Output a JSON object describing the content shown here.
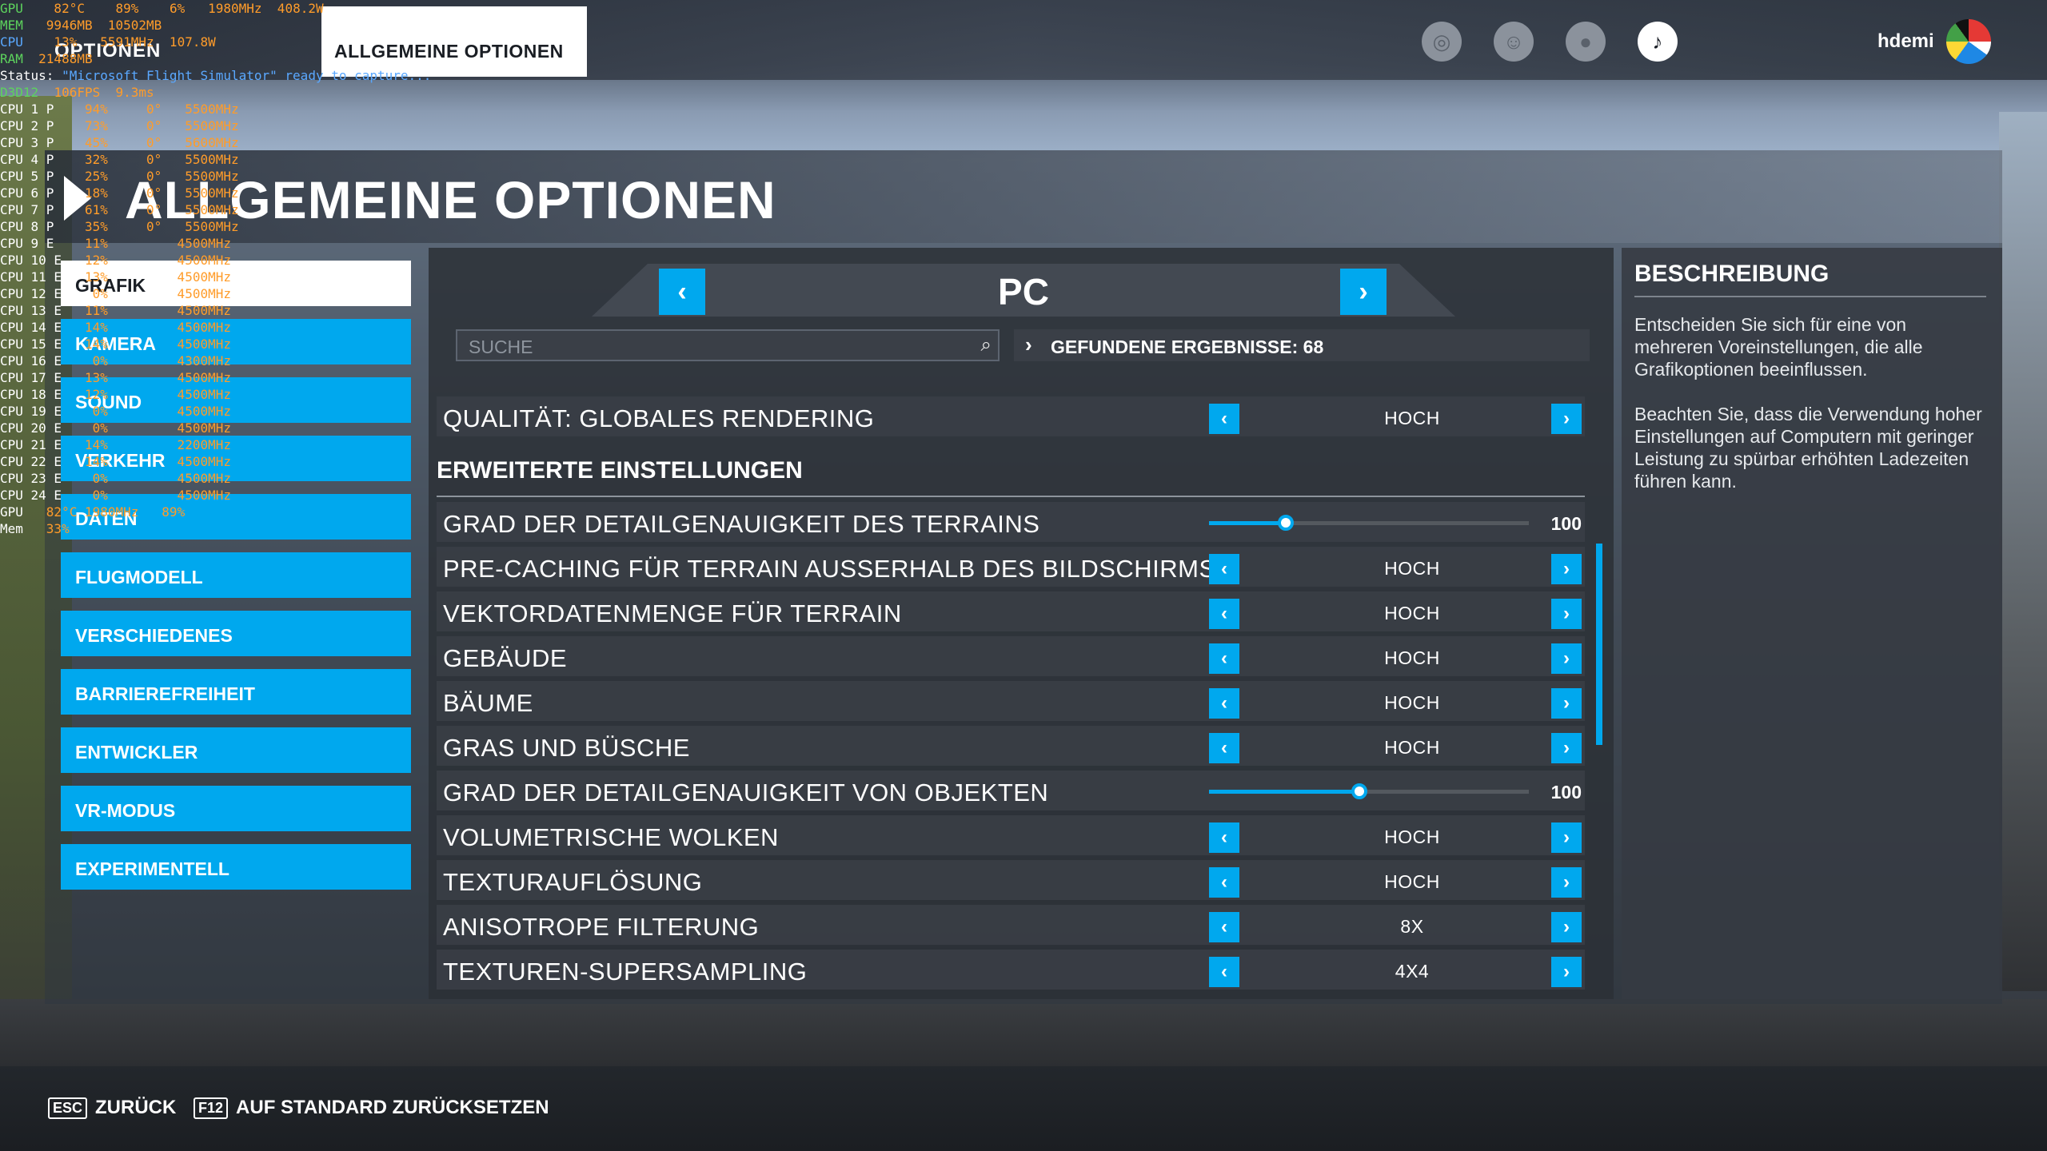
{
  "hud": {
    "rows": [
      {
        "label": "GPU",
        "v1": "82",
        "u1": "°C",
        "v2": "89",
        "u2": "%",
        "v3": "6",
        "u3": "%",
        "v4": "1980",
        "u4": "MHz",
        "v5": "408.2",
        "u5": "W"
      },
      {
        "label": "MEM",
        "v1": "9946",
        "u1": "MB",
        "v2": "10502",
        "u2": "MB",
        "v3": "",
        "u3": "",
        "v4": "",
        "u4": "",
        "v5": "",
        "u5": ""
      },
      {
        "label": "CPU",
        "v1": "13",
        "u1": "%",
        "v2": "5591",
        "u2": "MHz",
        "v3": "107.8",
        "u3": "W",
        "v4": "",
        "u4": "",
        "v5": "",
        "u5": ""
      },
      {
        "label": "RAM",
        "v1": "21488",
        "u1": "MB",
        "v2": "",
        "u2": "",
        "v3": "",
        "u3": "",
        "v4": "",
        "u4": "",
        "v5": "",
        "u5": ""
      }
    ],
    "status_label": "Status:",
    "status_text": "\"Microsoft Flight Simulator\" ready to capture...",
    "d3d_label": "D3D12",
    "d3d_fps": "106",
    "d3d_fps_unit": "FPS",
    "d3d_ms": "9.3",
    "d3d_ms_unit": "ms",
    "cpus": [
      {
        "name": "CPU 1 P",
        "load": "94",
        "temp": "0",
        "freq": "5500"
      },
      {
        "name": "CPU 2 P",
        "load": "73",
        "temp": "0",
        "freq": "5500"
      },
      {
        "name": "CPU 3 P",
        "load": "45",
        "temp": "0",
        "freq": "5600"
      },
      {
        "name": "CPU 4 P",
        "load": "32",
        "temp": "0",
        "freq": "5500"
      },
      {
        "name": "CPU 5 P",
        "load": "25",
        "temp": "0",
        "freq": "5500"
      },
      {
        "name": "CPU 6 P",
        "load": "18",
        "temp": "0",
        "freq": "5500"
      },
      {
        "name": "CPU 7 P",
        "load": "61",
        "temp": "0",
        "freq": "5500"
      },
      {
        "name": "CPU 8 P",
        "load": "35",
        "temp": "0",
        "freq": "5500"
      },
      {
        "name": "CPU 9 E",
        "load": "11",
        "temp": "",
        "freq": "4500"
      },
      {
        "name": "CPU 10 E",
        "load": "12",
        "temp": "",
        "freq": "4500"
      },
      {
        "name": "CPU 11 E",
        "load": "13",
        "temp": "",
        "freq": "4500"
      },
      {
        "name": "CPU 12 E",
        "load": "0",
        "temp": "",
        "freq": "4500"
      },
      {
        "name": "CPU 13 E",
        "load": "11",
        "temp": "",
        "freq": "4500"
      },
      {
        "name": "CPU 14 E",
        "load": "14",
        "temp": "",
        "freq": "4500"
      },
      {
        "name": "CPU 15 E",
        "load": "14",
        "temp": "",
        "freq": "4500"
      },
      {
        "name": "CPU 16 E",
        "load": "0",
        "temp": "",
        "freq": "4300"
      },
      {
        "name": "CPU 17 E",
        "load": "13",
        "temp": "",
        "freq": "4500"
      },
      {
        "name": "CPU 18 E",
        "load": "12",
        "temp": "",
        "freq": "4500"
      },
      {
        "name": "CPU 19 E",
        "load": "0",
        "temp": "",
        "freq": "4500"
      },
      {
        "name": "CPU 20 E",
        "load": "0",
        "temp": "",
        "freq": "4500"
      },
      {
        "name": "CPU 21 E",
        "load": "14",
        "temp": "",
        "freq": "2200"
      },
      {
        "name": "CPU 22 E",
        "load": "14",
        "temp": "",
        "freq": "4500"
      },
      {
        "name": "CPU 23 E",
        "load": "0",
        "temp": "",
        "freq": "4500"
      },
      {
        "name": "CPU 24 E",
        "load": "0",
        "temp": "",
        "freq": "4500"
      }
    ],
    "gpu2_label": "GPU",
    "gpu2_temp": "82",
    "gpu2_freq": "1980",
    "gpu2_load": "89",
    "mem2_label": "Mem",
    "mem2_val": "33"
  },
  "topbar": {
    "options_tab": "OPTIONEN",
    "active_tab": "ALLGEMEINE OPTIONEN",
    "username": "hdemi"
  },
  "page": {
    "title": "ALLGEMEINE OPTIONEN"
  },
  "sidebar": {
    "items": [
      {
        "label": "GRAFIK",
        "active": true
      },
      {
        "label": "KAMERA",
        "active": false
      },
      {
        "label": "SOUND",
        "active": false
      },
      {
        "label": "VERKEHR",
        "active": false
      },
      {
        "label": "DATEN",
        "active": false
      },
      {
        "label": "FLUGMODELL",
        "active": false
      },
      {
        "label": "VERSCHIEDENES",
        "active": false
      },
      {
        "label": "BARRIEREFREIHEIT",
        "active": false
      },
      {
        "label": "ENTWICKLER",
        "active": false
      },
      {
        "label": "VR-MODUS",
        "active": false
      },
      {
        "label": "EXPERIMENTELL",
        "active": false
      }
    ]
  },
  "preset": {
    "label": "PC"
  },
  "search": {
    "placeholder": "SUCHE",
    "value": "",
    "results": "GEFUNDENE ERGEBNISSE: 68"
  },
  "settings": {
    "global": {
      "label": "QUALITÄT: GLOBALES RENDERING",
      "value": "HOCH"
    },
    "section_title": "ERWEITERTE EINSTELLUNGEN",
    "rows": [
      {
        "label": "GRAD DER DETAILGENAUIGKEIT DES TERRAINS",
        "type": "slider",
        "value": "100",
        "fraction": 0.24
      },
      {
        "label": "PRE-CACHING FÜR TERRAIN AUSSERHALB DES BILDSCHIRMS",
        "type": "select",
        "value": "HOCH"
      },
      {
        "label": "VEKTORDATENMENGE FÜR TERRAIN",
        "type": "select",
        "value": "HOCH"
      },
      {
        "label": "GEBÄUDE",
        "type": "select",
        "value": "HOCH"
      },
      {
        "label": "BÄUME",
        "type": "select",
        "value": "HOCH"
      },
      {
        "label": "GRAS UND BÜSCHE",
        "type": "select",
        "value": "HOCH"
      },
      {
        "label": "GRAD DER DETAILGENAUIGKEIT VON OBJEKTEN",
        "type": "slider",
        "value": "100",
        "fraction": 0.47
      },
      {
        "label": "VOLUMETRISCHE WOLKEN",
        "type": "select",
        "value": "HOCH"
      },
      {
        "label": "TEXTURAUFLÖSUNG",
        "type": "select",
        "value": "HOCH"
      },
      {
        "label": "ANISOTROPE FILTERUNG",
        "type": "select",
        "value": "8X"
      },
      {
        "label": "TEXTUREN-SUPERSAMPLING",
        "type": "select",
        "value": "4X4"
      }
    ]
  },
  "description": {
    "title": "BESCHREIBUNG",
    "paragraphs": [
      "Entscheiden Sie sich für eine von mehreren Voreinstellungen, die alle Grafikoptionen beeinflussen.",
      "Beachten Sie, dass die Verwendung hoher Einstellungen auf Computern mit geringer Leistung zu spürbar erhöhten Ladezeiten führen kann."
    ]
  },
  "footer": {
    "back_key": "ESC",
    "back_label": "ZURÜCK",
    "reset_key": "F12",
    "reset_label": "AUF STANDARD ZURÜCKSETZEN"
  },
  "colors": {
    "accent": "#00a8ee",
    "hud_label_green": "#5dd35d",
    "hud_value_orange": "#ff9c2a"
  },
  "icons": {
    "chevron_left": "‹",
    "chevron_right": "›",
    "search": "⌕"
  }
}
